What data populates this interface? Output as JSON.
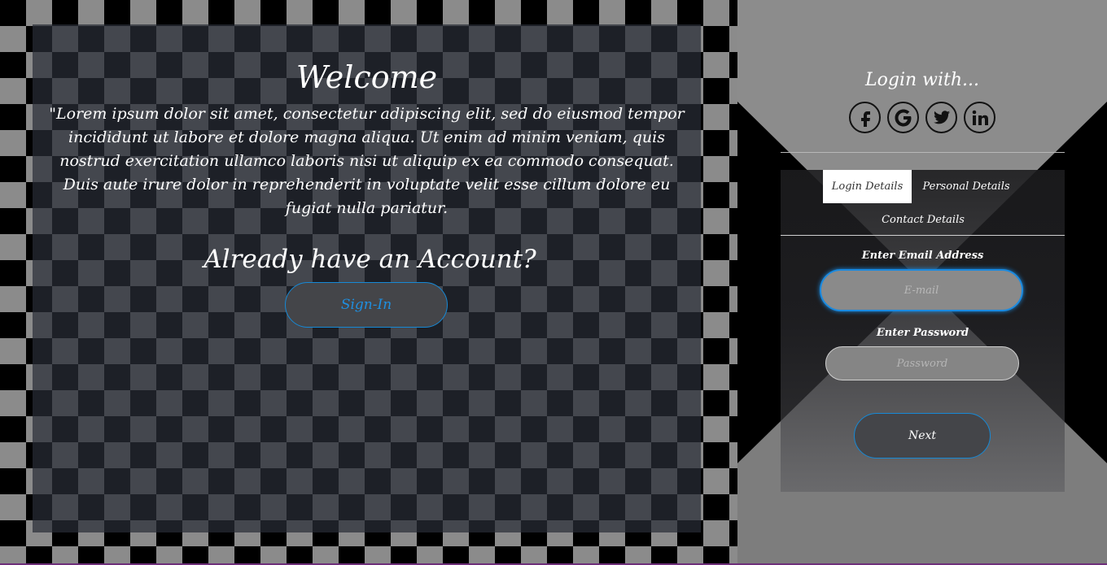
{
  "welcome": {
    "title": "Welcome",
    "text": "\"Lorem ipsum dolor sit amet, consectetur adipiscing elit, sed do eiusmod tempor incididunt ut labore et dolore magna aliqua. Ut enim ad minim veniam, quis nostrud exercitation ullamco laboris nisi ut aliquip ex ea commodo consequat. Duis aute irure dolor in reprehenderit in voluptate velit esse cillum dolore eu fugiat nulla pariatur.",
    "account_question": "Already have an Account?",
    "signin_label": "Sign-In"
  },
  "login": {
    "title": "Login with...",
    "social": [
      {
        "icon": "facebook-icon"
      },
      {
        "icon": "google-icon"
      },
      {
        "icon": "twitter-icon"
      },
      {
        "icon": "linkedin-icon"
      }
    ]
  },
  "tabs": {
    "login_details": "Login Details",
    "personal_details": "Personal Details",
    "contact_details": "Contact Details",
    "active": "Login Details"
  },
  "form": {
    "email_label": "Enter Email Address",
    "email_placeholder": "E-mail",
    "password_label": "Enter Password",
    "password_placeholder": "Password",
    "next_label": "Next"
  },
  "colors": {
    "accent": "#1a8ae0",
    "panel": "#282c36",
    "button_bg": "#444549"
  }
}
